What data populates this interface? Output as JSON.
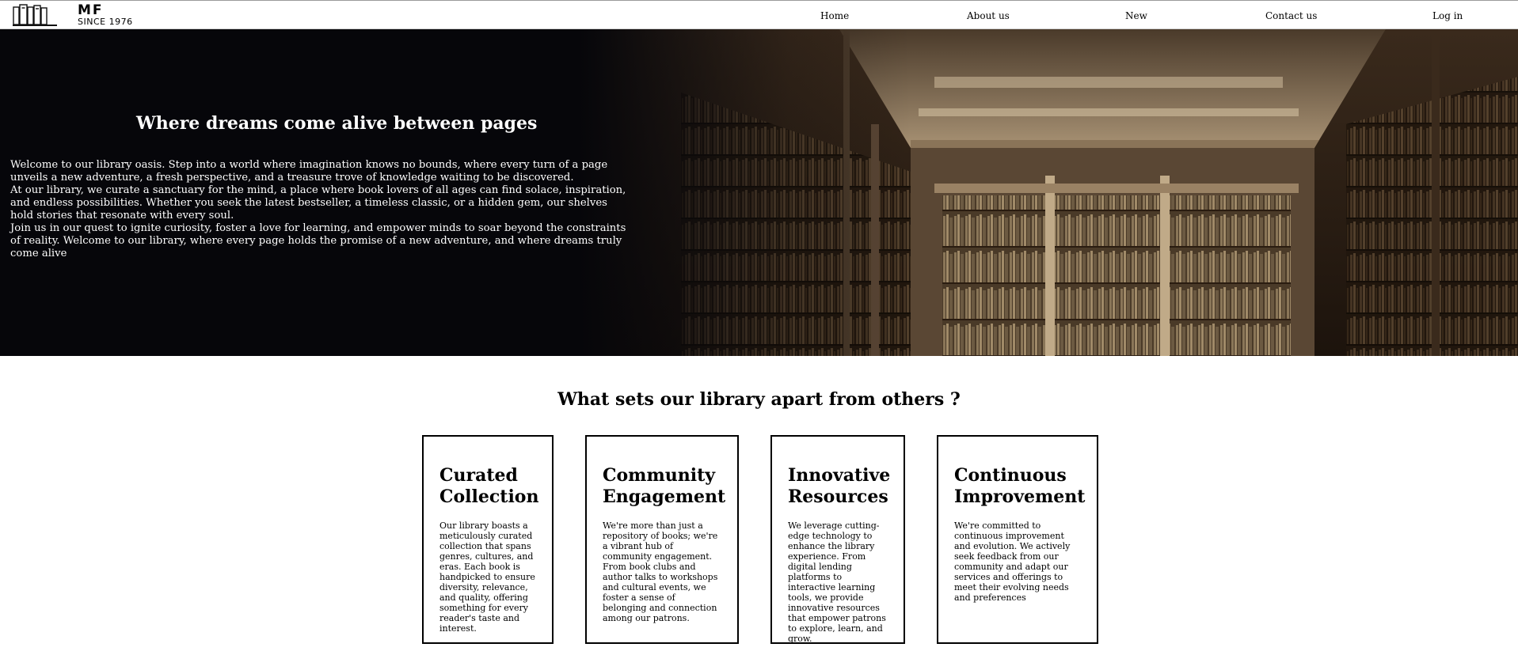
{
  "header": {
    "logo": {
      "name": "MF",
      "tagline": "SINCE 1976"
    },
    "nav": [
      {
        "label": "Home"
      },
      {
        "label": "About us"
      },
      {
        "label": "New"
      },
      {
        "label": "Contact us"
      },
      {
        "label": "Log in"
      }
    ]
  },
  "hero": {
    "title": "Where dreams come alive between pages",
    "paragraphs": [
      "Welcome to our library oasis. Step into a world where imagination knows no bounds, where every turn of a page unveils a new adventure, a fresh perspective, and a treasure trove of knowledge waiting to be discovered.",
      "At our library, we curate a sanctuary for the mind, a place where book lovers of all ages can find solace, inspiration, and endless possibilities. Whether you seek the latest bestseller, a timeless classic, or a hidden gem, our shelves hold stories that resonate with every soul.",
      "Join us in our quest to ignite curiosity, foster a love for learning, and empower minds to soar beyond the constraints of reality. Welcome to our library, where every page holds the promise of a new adventure, and where dreams truly come alive"
    ],
    "image_icon": "library-bookshelves-image"
  },
  "features": {
    "title": "What sets our library apart from others ?",
    "cards": [
      {
        "title": "Curated Collection",
        "text": "Our library boasts a meticulously curated collection that spans genres, cultures, and eras. Each book is handpicked to ensure diversity, relevance, and quality, offering something for every reader's taste and interest."
      },
      {
        "title": "Community Engagement",
        "text": "We're more than just a repository of books; we're a vibrant hub of community engagement. From book clubs and author talks to workshops and cultural events, we foster a sense of belonging and connection among our patrons."
      },
      {
        "title": "Innovative Resources",
        "text": "We leverage cutting-edge technology to enhance the library experience. From digital lending platforms to interactive learning tools, we provide innovative resources that empower patrons to explore, learn, and grow."
      },
      {
        "title": "Continuous Improvement",
        "text": "We're committed to continuous improvement and evolution. We actively seek feedback from our community and adapt our services and offerings to meet their evolving needs and preferences"
      }
    ]
  },
  "colors": {
    "hero_background": "#06060a",
    "hero_text": "#ffffff",
    "card_border": "#000000"
  }
}
